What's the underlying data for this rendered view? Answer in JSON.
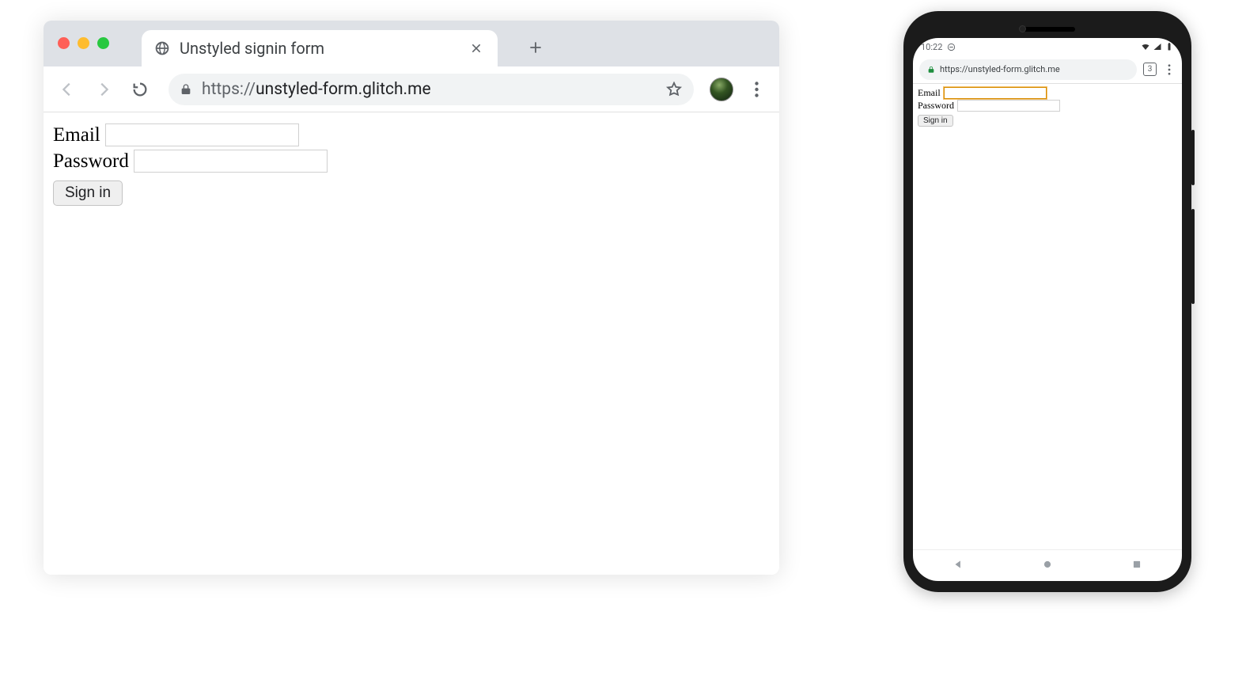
{
  "desktop": {
    "tab_title": "Unstyled signin form",
    "url_scheme": "https://",
    "url_origin": "unstyled-form.glitch.me",
    "form": {
      "email_label": "Email",
      "password_label": "Password",
      "signin_label": "Sign in"
    }
  },
  "phone": {
    "status_time": "10:22",
    "url": "https://unstyled-form.glitch.me",
    "tab_count": "3",
    "form": {
      "email_label": "Email",
      "password_label": "Password",
      "signin_label": "Sign in"
    }
  }
}
